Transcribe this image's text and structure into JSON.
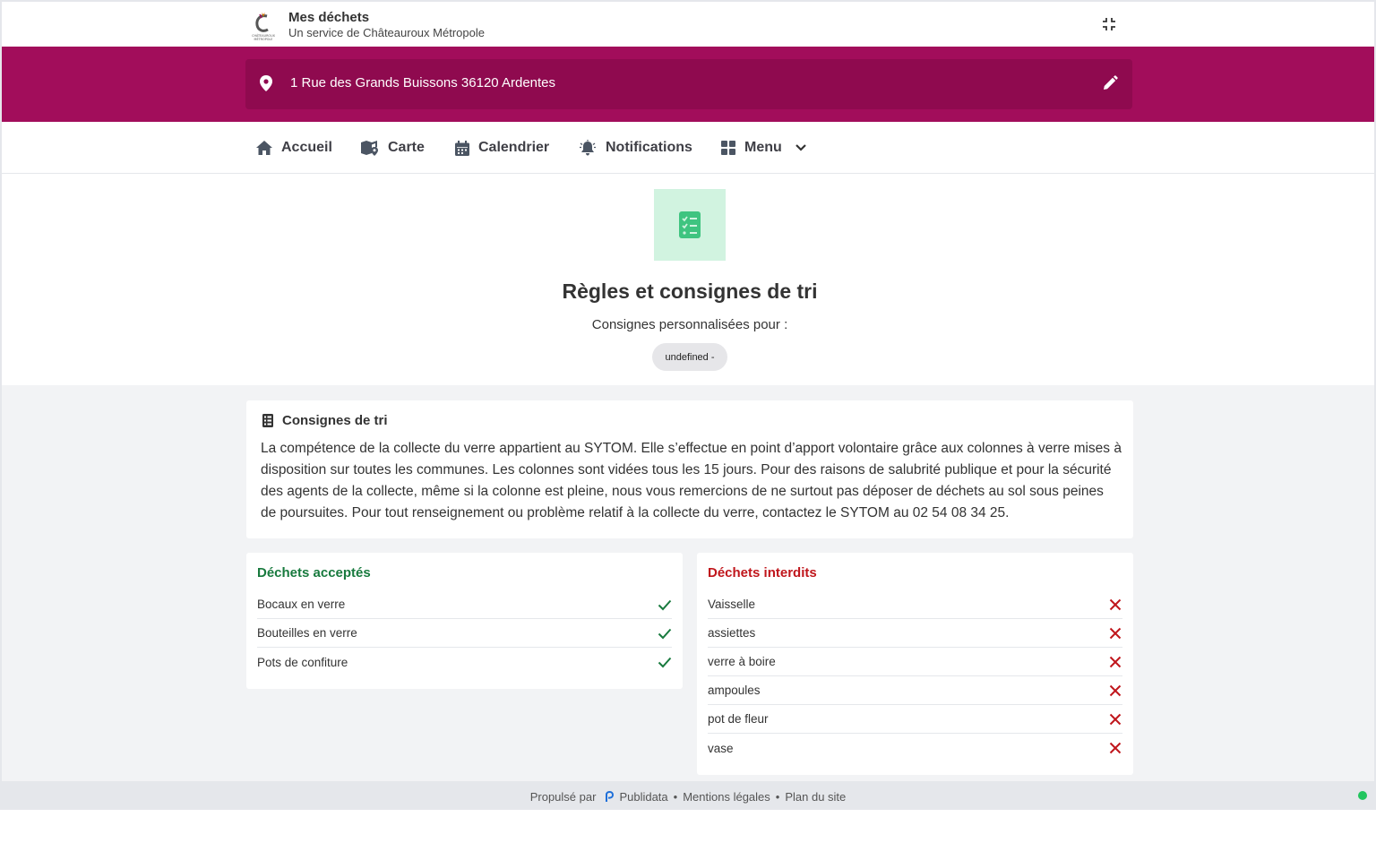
{
  "header": {
    "title": "Mes déchets",
    "subtitle": "Un service de Châteauroux Métropole",
    "logo_icon": "chateauroux-metropole-logo",
    "collapse_icon": "compress-icon"
  },
  "address": {
    "text": "1 Rue des Grands Buissons 36120 Ardentes",
    "pin_icon": "map-pin-icon",
    "edit_icon": "pencil-icon"
  },
  "nav": {
    "items": [
      {
        "label": "Accueil",
        "icon": "home-icon"
      },
      {
        "label": "Carte",
        "icon": "map-icon"
      },
      {
        "label": "Calendrier",
        "icon": "calendar-icon"
      },
      {
        "label": "Notifications",
        "icon": "bell-icon"
      },
      {
        "label": "Menu",
        "icon": "grid-icon"
      }
    ]
  },
  "hero": {
    "title": "Règles et consignes de tri",
    "subtitle": "Consignes personnalisées pour :",
    "chip": "undefined -",
    "icon": "checklist-icon"
  },
  "info": {
    "heading": "Consignes de tri",
    "body": "La compétence de la collecte du verre appartient au SYTOM. Elle s’effectue en point d’apport volontaire grâce aux colonnes à verre mises à disposition sur toutes les communes. Les colonnes sont vidées tous les 15 jours. Pour des raisons de salubrité publique et pour la sécurité des agents de la collecte, même si la colonne est pleine, nous vous remercions de ne surtout pas déposer de déchets au sol sous peines de poursuites. Pour tout renseignement ou problème relatif à la collecte du verre, contactez le SYTOM au 02 54 08 34 25."
  },
  "accepted": {
    "title": "Déchets acceptés",
    "items": [
      "Bocaux en verre",
      "Bouteilles en verre",
      "Pots de confiture"
    ]
  },
  "forbidden": {
    "title": "Déchets interdits",
    "items": [
      "Vaisselle",
      "assiettes",
      "verre à boire",
      "ampoules",
      "pot de fleur",
      "vase"
    ]
  },
  "footer": {
    "powered": "Propulsé par",
    "brand": "Publidata",
    "legal": "Mentions légales",
    "sitemap": "Plan du site",
    "sep": "•"
  },
  "colors": {
    "brand": "#a20d5b",
    "brand_dark": "#8f0a4f",
    "accepted": "#187a3e",
    "forbidden": "#c0161c",
    "status": "#22c55e"
  }
}
